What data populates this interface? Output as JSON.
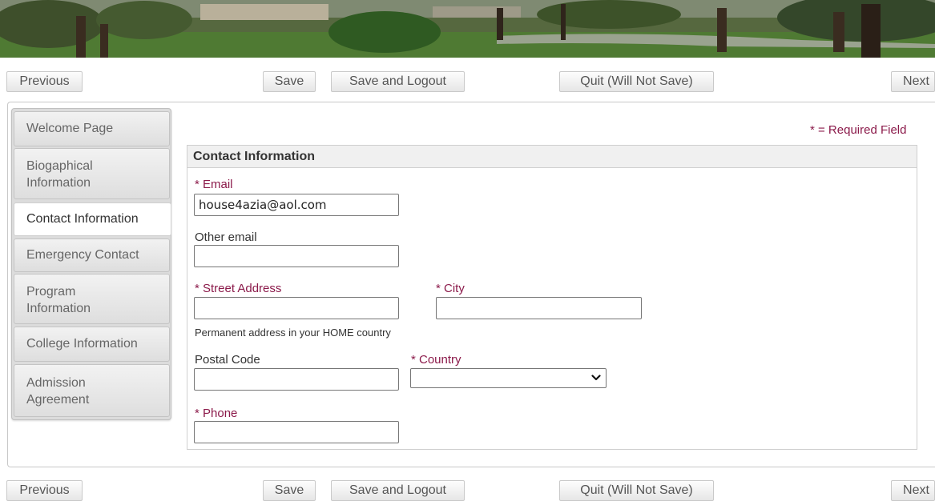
{
  "nav": {
    "previous": "Previous",
    "save": "Save",
    "save_logout": "Save and Logout",
    "quit": "Quit (Will Not Save)",
    "next": "Next"
  },
  "sidebar": {
    "items": [
      {
        "label": "Welcome Page",
        "active": false
      },
      {
        "label": "Biogaphical Information",
        "line1": "Biogaphical",
        "line2": "Information",
        "active": false
      },
      {
        "label": "Contact Information",
        "active": true
      },
      {
        "label": "Emergency Contact",
        "active": false
      },
      {
        "label": "Program Information",
        "line1": "Program",
        "line2": "Information",
        "active": false
      },
      {
        "label": "College Information",
        "active": false
      },
      {
        "label": "Admission Agreement",
        "line1": "Admission",
        "line2": "Agreement",
        "active": false
      }
    ]
  },
  "required_note": "* = Required Field",
  "form": {
    "title": "Contact Information",
    "email_label": "* Email",
    "email_value": "house4azia@aol.com",
    "other_email_label": "Other email",
    "other_email_value": "",
    "street_label": "* Street Address",
    "street_value": "",
    "city_label": "* City",
    "city_value": "",
    "address_hint": "Permanent address in your HOME country",
    "postal_label": "Postal Code",
    "postal_value": "",
    "country_label": "* Country",
    "country_value": "",
    "phone_label": "* Phone",
    "phone_value": ""
  },
  "colors": {
    "required_accent": "#8b1a4a",
    "tab_inactive": "#dedede",
    "tab_active": "#ffffff"
  },
  "icons": {
    "country_select": "chevron-down-icon"
  }
}
